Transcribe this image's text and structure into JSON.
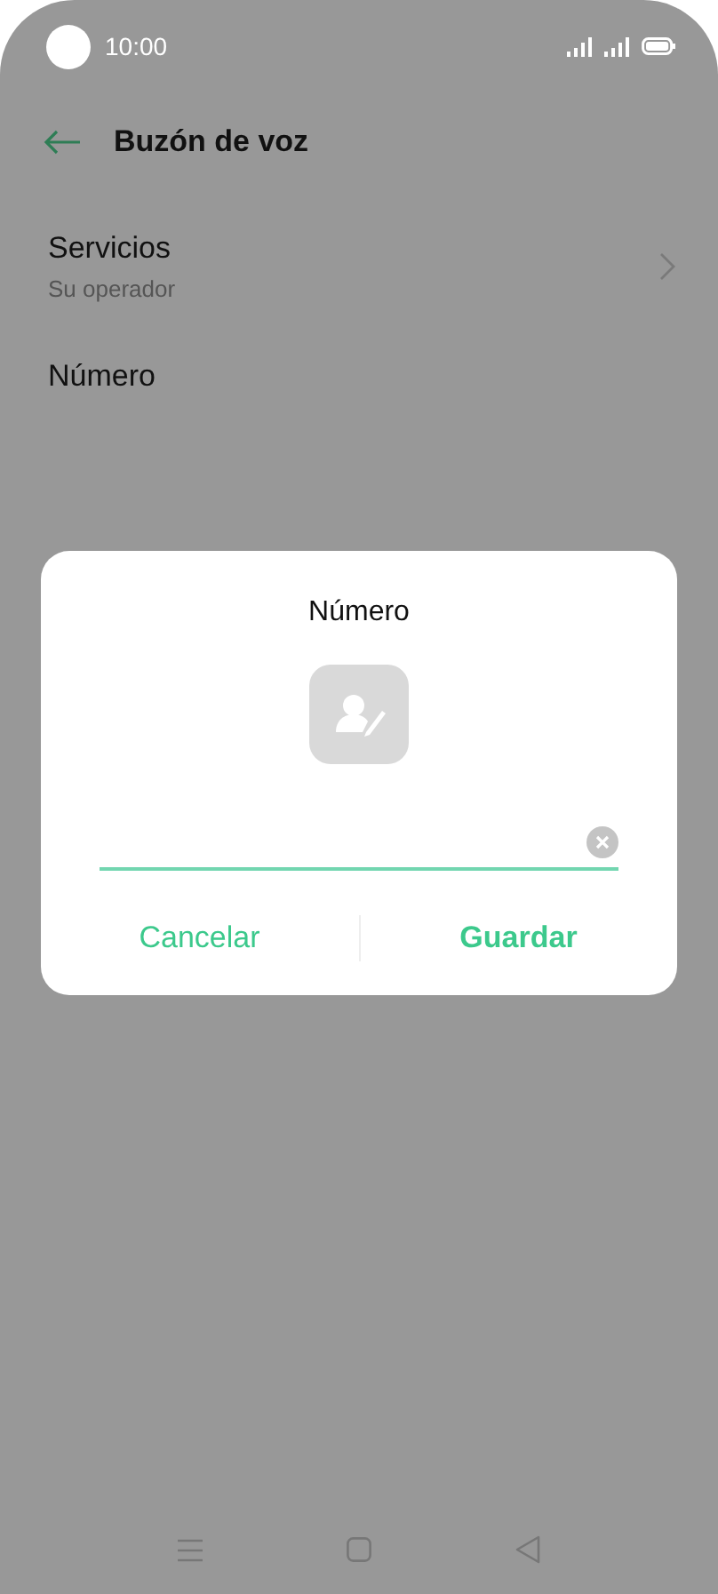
{
  "status_bar": {
    "time": "10:00"
  },
  "header": {
    "title": "Buzón de voz"
  },
  "settings": [
    {
      "title": "Servicios",
      "subtitle": "Su operador",
      "has_chevron": true
    },
    {
      "title": "Número",
      "has_chevron": false
    }
  ],
  "dialog": {
    "title": "Número",
    "buttons": [
      {
        "label": "Cancelar",
        "primary": false
      },
      {
        "label": "Guardar",
        "primary": true
      }
    ]
  }
}
